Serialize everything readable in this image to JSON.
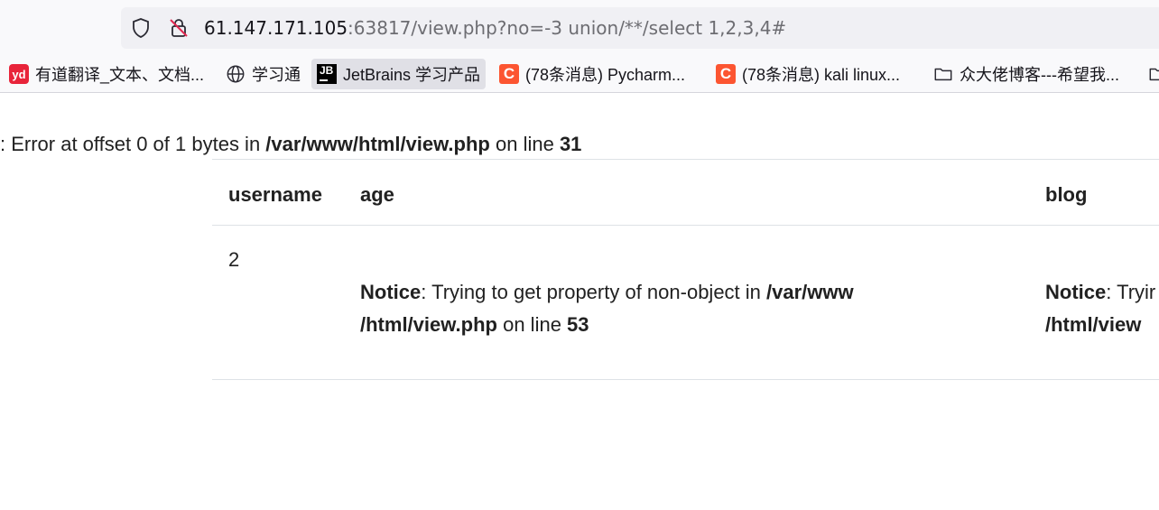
{
  "address_bar": {
    "url_host": "61.147.171.105",
    "url_rest": ":63817/view.php?no=-3 union/**/select 1,2,3,4#",
    "icons": [
      "shield-icon",
      "insecure-lock-icon"
    ]
  },
  "bookmarks": [
    {
      "label": "有道翻译_文本、文档...",
      "icon": "youdao-icon"
    },
    {
      "label": "学习通",
      "icon": "globe-icon"
    },
    {
      "label": "JetBrains 学习产品",
      "icon": "jetbrains-icon"
    },
    {
      "label": "(78条消息) Pycharm...",
      "icon": "csdn-icon"
    },
    {
      "label": "(78条消息) kali linux...",
      "icon": "csdn-icon"
    },
    {
      "label": "众大佬博客---希望我...",
      "icon": "folder-icon"
    }
  ],
  "error_line": {
    "prefix": ": Error at offset 0 of 1 bytes in ",
    "file": "/var/www/html/view.php",
    "middle": " on line ",
    "line": "31"
  },
  "table": {
    "headers": [
      "username",
      "age",
      "blog"
    ],
    "row": {
      "username": "2",
      "age_notice": {
        "label": "Notice",
        "message": ": Trying to get property of non-object in ",
        "file": "/var/www /html/view.php",
        "middle": " on line ",
        "line": "53"
      },
      "blog_notice": {
        "label": "Notice",
        "message": ": Tryir",
        "file": "/html/view"
      }
    }
  },
  "colors": {
    "csdn": "#fc5531",
    "youdao": "#e8243a",
    "border": "#dee2e6"
  }
}
